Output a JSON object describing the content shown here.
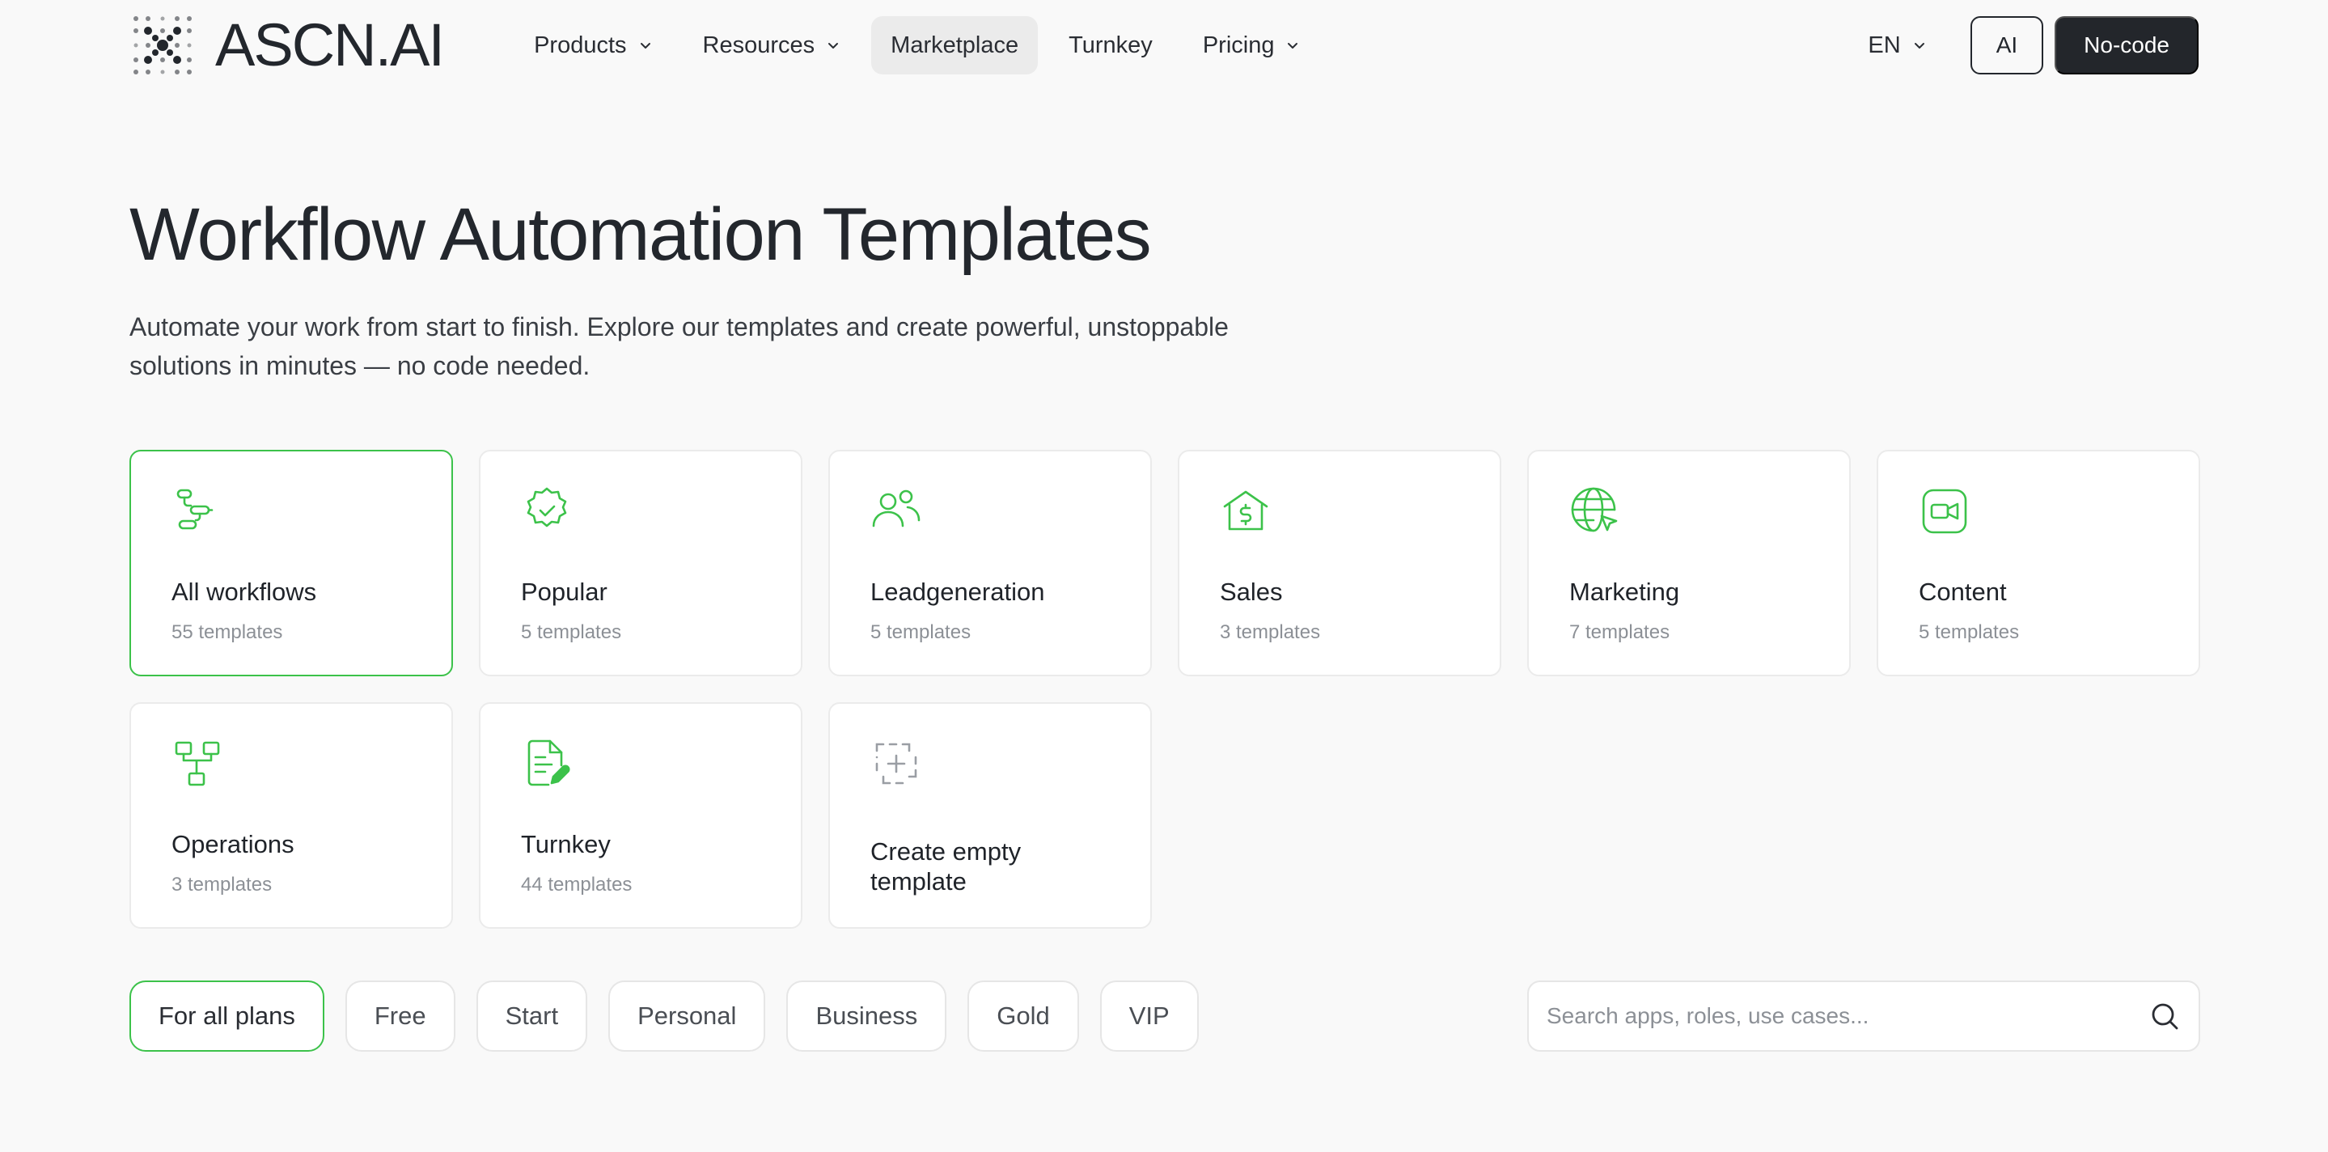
{
  "brand": {
    "name": "ASCN.AI"
  },
  "nav": {
    "links": [
      {
        "label": "Products",
        "dropdown": true
      },
      {
        "label": "Resources",
        "dropdown": true
      },
      {
        "label": "Marketplace",
        "active": true
      },
      {
        "label": "Turnkey"
      },
      {
        "label": "Pricing",
        "dropdown": true
      }
    ],
    "language": "EN",
    "ai_button": "AI",
    "nocode_button": "No-code"
  },
  "hero": {
    "title": "Workflow Automation Templates",
    "subtitle": "Automate your work from start to finish. Explore our templates and create powerful, unstoppable solutions in minutes — no code needed."
  },
  "categories": [
    {
      "name": "All workflows",
      "count": "55 templates",
      "icon": "workflow-icon",
      "selected": true
    },
    {
      "name": "Popular",
      "count": "5 templates",
      "icon": "badge-check-icon"
    },
    {
      "name": "Leadgeneration",
      "count": "5 templates",
      "icon": "users-icon"
    },
    {
      "name": "Sales",
      "count": "3 templates",
      "icon": "house-dollar-icon"
    },
    {
      "name": "Marketing",
      "count": "7 templates",
      "icon": "globe-cursor-icon"
    },
    {
      "name": "Content",
      "count": "5 templates",
      "icon": "video-icon"
    },
    {
      "name": "Operations",
      "count": "3 templates",
      "icon": "hierarchy-icon"
    },
    {
      "name": "Turnkey",
      "count": "44 templates",
      "icon": "document-edit-icon"
    },
    {
      "name": "Create empty template",
      "icon": "add-dashed-icon"
    }
  ],
  "plans": [
    {
      "label": "For all plans",
      "selected": true
    },
    {
      "label": "Free"
    },
    {
      "label": "Start"
    },
    {
      "label": "Personal"
    },
    {
      "label": "Business"
    },
    {
      "label": "Gold"
    },
    {
      "label": "VIP"
    }
  ],
  "search": {
    "placeholder": "Search apps, roles, use cases...",
    "value": ""
  },
  "colors": {
    "accent": "#3cc24a",
    "dark": "#23262b",
    "background": "#f9f9f9"
  }
}
